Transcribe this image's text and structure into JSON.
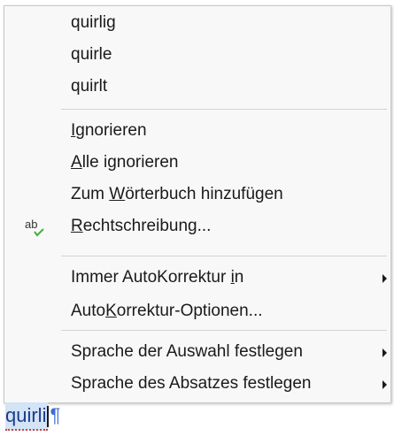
{
  "menu": {
    "suggestions": [
      "quirlig",
      "quirle",
      "quirlt"
    ],
    "ignore": {
      "prefix": "",
      "mnemonic": "I",
      "rest": "gnorieren"
    },
    "ignore_all": {
      "prefix": "",
      "mnemonic": "A",
      "rest": "lle ignorieren"
    },
    "add_dictionary": {
      "prefix": "Zum ",
      "mnemonic": "W",
      "rest": "örterbuch hinzufügen"
    },
    "spelling": {
      "prefix": "",
      "mnemonic": "R",
      "rest": "echtschreibung..."
    },
    "spelling_icon_text": "ab",
    "always_autocorrect": {
      "prefix": "Immer AutoKorrektur ",
      "mnemonic": "i",
      "rest": "n"
    },
    "autocorrect_options": {
      "prefix": "Auto",
      "mnemonic": "K",
      "rest": "orrektur-Optionen..."
    },
    "set_language_selection": "Sprache der Auswahl festlegen",
    "set_language_paragraph": "Sprache des Absatzes festlegen"
  },
  "document": {
    "word": "quirli",
    "pilcrow": "¶"
  },
  "colors": {
    "menu_bg": "#f8f8f8",
    "separator": "#d4d4d4",
    "selection": "#d2e4f6",
    "spell_underline": "#d04040",
    "check_icon": "#3fae3f"
  }
}
